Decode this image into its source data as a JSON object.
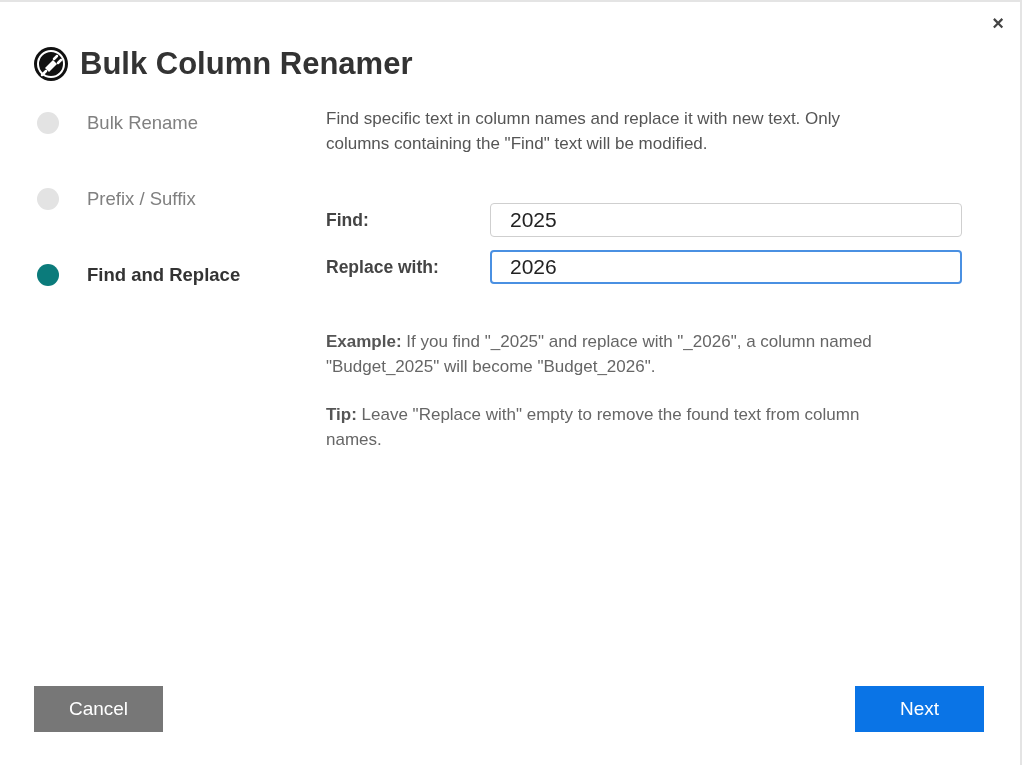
{
  "dialog": {
    "title": "Bulk Column Renamer",
    "close": "×"
  },
  "steps": [
    {
      "label": "Bulk Rename",
      "selected": false
    },
    {
      "label": "Prefix / Suffix",
      "selected": false
    },
    {
      "label": "Find and Replace",
      "selected": true
    }
  ],
  "description": "Find specific text in column names and replace it with new text. Only columns containing the \"Find\" text will be modified.",
  "fields": [
    {
      "label": "Find:",
      "value": "2025",
      "focused": false
    },
    {
      "label": "Replace with:",
      "value": "2026",
      "focused": true
    }
  ],
  "notes": [
    "**Example:** If you find \"_2025\" and replace with \"_2026\", a column named \"Budget_2025\" will become \"Budget_2026\".",
    "**Tip:** Leave \"Replace with\" empty to remove the found text from column names."
  ],
  "buttons": [
    {
      "label": "Cancel",
      "kind": "secondary"
    },
    {
      "label": "Next",
      "kind": "primary"
    }
  ]
}
